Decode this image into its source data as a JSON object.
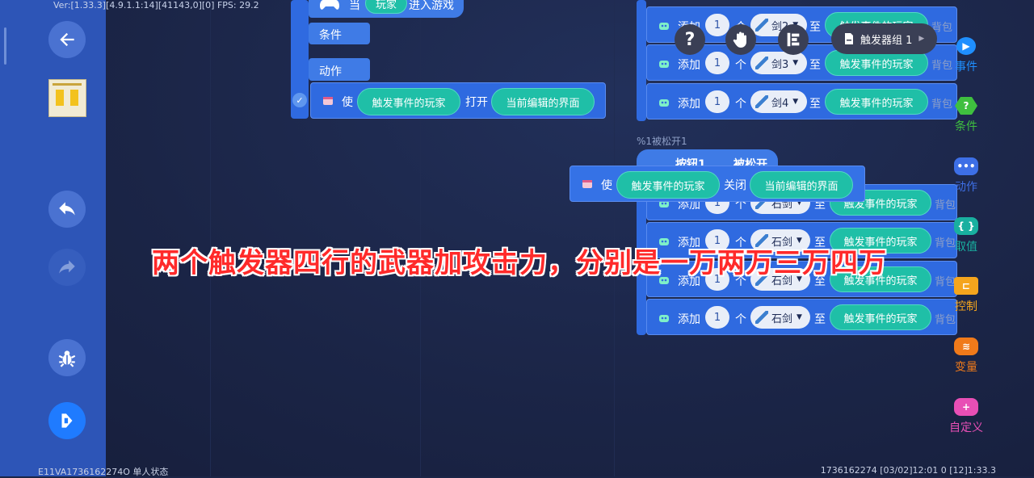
{
  "status": {
    "version": "Ver:[1.33.3][4.9.1.1:14][41143,0][0] FPS: 29.2",
    "bottom_left": "E11VA1736162274O 单人状态",
    "bottom_right": "1736162274 [03/02]12:01 0 [12]1:33.3"
  },
  "left_toolbar": {
    "buttons": [
      "back-icon",
      "project-thumbnail",
      "undo-icon",
      "redo-icon",
      "debug-bug-icon",
      "run-icon"
    ]
  },
  "script1": {
    "event_when": "当",
    "event_player": "玩家",
    "event_enter": "进入游戏",
    "condition_label": "条件",
    "action_label": "动作",
    "use_word": "使",
    "target": "触发事件的玩家",
    "verb_open": "打开",
    "ui": "当前编辑的界面"
  },
  "script2": {
    "rows": [
      {
        "add": "添加",
        "count": "1",
        "unit": "个",
        "item": "剑2",
        "to": "至",
        "target": "触发事件的玩家",
        "bag": "背包"
      },
      {
        "add": "添加",
        "count": "1",
        "unit": "个",
        "item": "剑3",
        "to": "至",
        "target": "触发事件的玩家",
        "bag": "背包"
      },
      {
        "add": "添加",
        "count": "1",
        "unit": "个",
        "item": "剑4",
        "to": "至",
        "target": "触发事件的玩家",
        "bag": "背包"
      }
    ]
  },
  "script3": {
    "comment": "%1被松开1",
    "button_name": "按钮1",
    "released": "被松开",
    "rows": [
      {
        "add": "添加",
        "count": "1",
        "unit": "个",
        "item": "石剑",
        "to": "至",
        "target": "触发事件的玩家",
        "bag": "背包"
      },
      {
        "add": "添加",
        "count": "1",
        "unit": "个",
        "item": "石剑",
        "to": "至",
        "target": "触发事件的玩家",
        "bag": "背包"
      },
      {
        "add": "添加",
        "count": "1",
        "unit": "个",
        "item": "石剑",
        "to": "至",
        "target": "触发事件的玩家",
        "bag": "背包"
      },
      {
        "add": "添加",
        "count": "1",
        "unit": "个",
        "item": "石剑",
        "to": "至",
        "target": "触发事件的玩家",
        "bag": "背包"
      }
    ]
  },
  "dragging_block": {
    "use_word": "使",
    "target": "触发事件的玩家",
    "verb_close": "关闭",
    "ui": "当前编辑的界面"
  },
  "floating_controls": {
    "help": "?",
    "trigger_group": "触发器组 1"
  },
  "palette": [
    {
      "label": "事件",
      "color": "#1f8fff",
      "icon": "event-icon"
    },
    {
      "label": "条件",
      "color": "#3fbf3f",
      "icon": "condition-icon"
    },
    {
      "label": "动作",
      "color": "#3d6fe6",
      "icon": "action-icon"
    },
    {
      "label": "取值",
      "color": "#19b0a0",
      "icon": "value-icon"
    },
    {
      "label": "控制",
      "color": "#f5a51d",
      "icon": "control-icon"
    },
    {
      "label": "变量",
      "color": "#f07a1a",
      "icon": "variable-icon"
    },
    {
      "label": "自定义",
      "color": "#e84fb5",
      "icon": "custom-icon"
    }
  ],
  "caption": "两个触发器四行的武器加攻击力，分别是一万两万三万四万"
}
